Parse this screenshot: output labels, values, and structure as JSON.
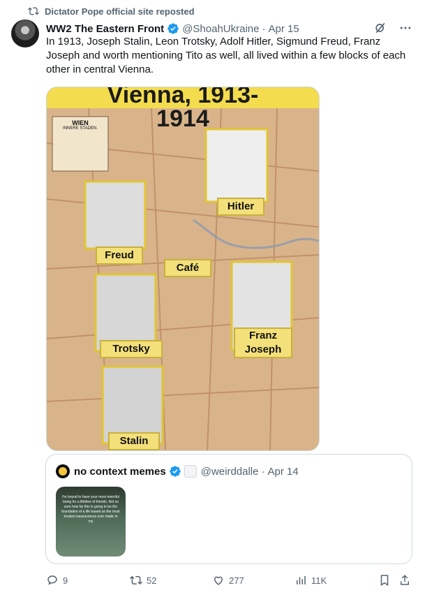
{
  "repost": {
    "text": "Dictator Pope official site reposted"
  },
  "tweet": {
    "name": "WW2 The Eastern Front",
    "handle": "@ShoahUkraine",
    "dot": "·",
    "date": "Apr 15",
    "text": "In 1913, Joseph Stalin, Leon Trotsky, Adolf Hitler, Sigmund Freud, Franz Joseph and worth mentioning Tito as well, all lived within a few blocks of each other in central Vienna."
  },
  "image": {
    "title": "Vienna, 1913-1914",
    "legend_title": "WIEN",
    "legend_subtitle": "INNERE STADEN.",
    "labels": {
      "hitler": "Hitler",
      "freud": "Freud",
      "cafe": "Café",
      "trotsky": "Trotsky",
      "franz": "Franz Joseph",
      "stalin": "Stalin"
    }
  },
  "quote": {
    "name": "no context memes",
    "handle": "@weirddalle",
    "dot": "·",
    "date": "Apr 14",
    "thumb_text": "I'm bound to have your most merciful being for a lifetime of friends. Not so sure how far this is going to be the foundation of a life based on the most trusted reassurances ever made in my"
  },
  "actions": {
    "replies": "9",
    "reposts": "52",
    "likes": "277",
    "views": "11K"
  }
}
